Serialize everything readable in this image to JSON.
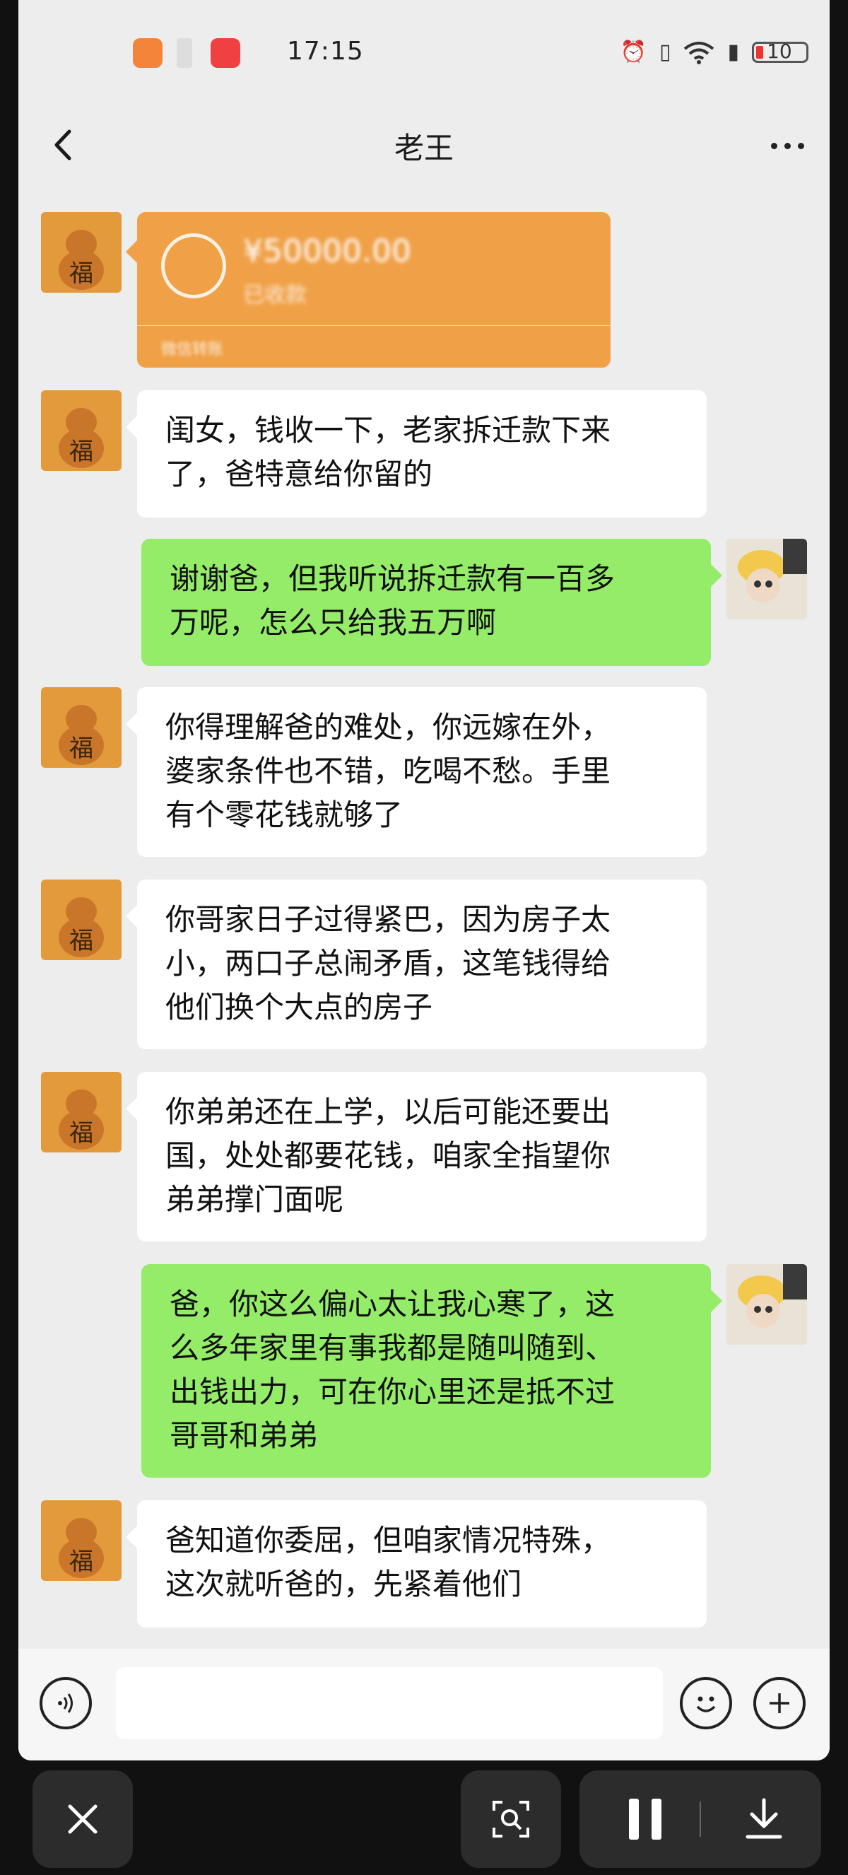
{
  "status_bar": {
    "time": "17:15",
    "battery_level": "10",
    "icons": [
      "heart-app-icon",
      "notification-icon",
      "red-app-icon",
      "alarm-icon",
      "vibrate-icon",
      "wifi-icon",
      "battery-icon"
    ]
  },
  "header": {
    "title": "老王",
    "back_icon": "chevron-left-icon",
    "more_icon": "more-dots-icon"
  },
  "transfer": {
    "amount": "¥50000.00",
    "note": "已收款",
    "footer": "微信转账",
    "color": "#f0a148"
  },
  "messages": [
    {
      "sender": "dad",
      "text_lines": [
        "闺女，钱收一下，老家拆迁款下来",
        "了，爸特意给你留的"
      ]
    },
    {
      "sender": "me",
      "text_lines": [
        "谢谢爸，但我听说拆迁款有一百多",
        "万呢，怎么只给我五万啊"
      ]
    },
    {
      "sender": "dad",
      "text_lines": [
        "你得理解爸的难处，你远嫁在外，",
        "婆家条件也不错，吃喝不愁。手里",
        "有个零花钱就够了"
      ]
    },
    {
      "sender": "dad",
      "text_lines": [
        "你哥家日子过得紧巴，因为房子太",
        "小，两口子总闹矛盾，这笔钱得给",
        "他们换个大点的房子"
      ]
    },
    {
      "sender": "dad",
      "text_lines": [
        "你弟弟还在上学，以后可能还要出",
        "国，处处都要花钱，咱家全指望你",
        "弟弟撑门面呢"
      ]
    },
    {
      "sender": "me",
      "text_lines": [
        "爸，你这么偏心太让我心寒了，这",
        "么多年家里有事我都是随叫随到、",
        "出钱出力，可在你心里还是抵不过",
        "哥哥和弟弟"
      ]
    },
    {
      "sender": "dad",
      "text_lines": [
        "爸知道你委屈，但咱家情况特殊，",
        "这次就听爸的，先紧着他们"
      ]
    }
  ],
  "input_bar": {
    "voice_icon": "voice-icon",
    "emoji_icon": "emoji-icon",
    "plus_icon": "plus-icon",
    "placeholder": ""
  },
  "colors": {
    "my_bubble": "#95ec69",
    "other_bubble": "#ffffff",
    "background": "#ededed"
  },
  "screen_recorder": {
    "close_icon": "close-icon",
    "screenshot_icon": "scan-search-icon",
    "pause_icon": "pause-icon",
    "download_icon": "download-icon"
  }
}
